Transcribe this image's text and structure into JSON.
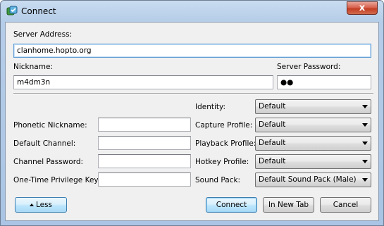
{
  "window": {
    "title": "Connect",
    "close_glyph": "x"
  },
  "icons": {
    "app": "teamspeak-icon",
    "close": "close-icon"
  },
  "server_address": {
    "label": "Server Address:",
    "value": "clanhome.hopto.org"
  },
  "nickname": {
    "label": "Nickname:",
    "value": "m4dm3n"
  },
  "server_password": {
    "label": "Server Password:",
    "value": "●●"
  },
  "left_fields": [
    {
      "label": "Phonetic Nickname:",
      "value": ""
    },
    {
      "label": "Default Channel:",
      "value": ""
    },
    {
      "label": "Channel Password:",
      "value": ""
    },
    {
      "label": "One-Time Privilege Key:",
      "value": ""
    }
  ],
  "identity": {
    "label": "Identity:",
    "value": "Default"
  },
  "capture_profile": {
    "label": "Capture Profile:",
    "value": "Default"
  },
  "playback_profile": {
    "label": "Playback Profile:",
    "value": "Default"
  },
  "hotkey_profile": {
    "label": "Hotkey Profile:",
    "value": "Default"
  },
  "sound_pack": {
    "label": "Sound Pack:",
    "value": "Default Sound Pack (Male)"
  },
  "buttons": {
    "less": "Less",
    "connect": "Connect",
    "new_tab": "In New Tab",
    "cancel": "Cancel"
  },
  "colors": {
    "focus_border": "#5d9bd4",
    "close_red": "#c23e24",
    "dialog_bg": "#f0f0f0"
  }
}
